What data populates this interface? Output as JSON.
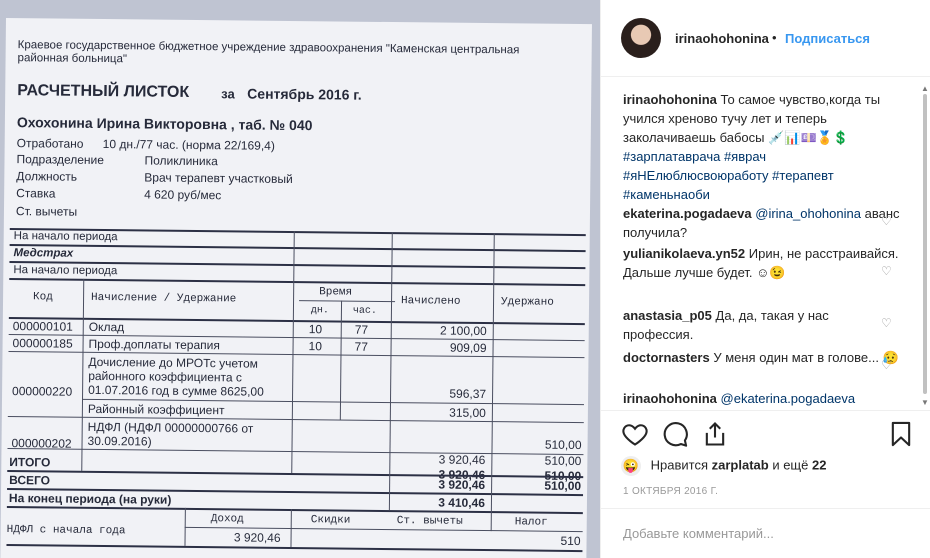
{
  "sheet": {
    "org": "Краевое государственное бюджетное учреждение здравоохранения \"Каменская центральная районная больница\"",
    "org_line1": "Краевое государственное бюджетное учреждение здравоохранения \"Каменская центральная",
    "org_line2": "районная больница\"",
    "title": "РАСЧЕТНЫЙ ЛИСТОК",
    "for_label": "за",
    "period": "Сентябрь 2016 г.",
    "employee": "Охохонина Ирина Викторовна , таб. № 040",
    "worked_label": "Отработано",
    "worked_value": "10 дн./77 час. (норма 22/169,4)",
    "dept_label": "Подразделение",
    "dept_value": "Поликлиника",
    "position_label": "Должность",
    "position_value": "Врач терапевт участковый",
    "rate_label": "Ставка",
    "rate_value": "4 620 руб/мес",
    "deductions_label": "Ст. вычеты",
    "start_period": "На начало периода",
    "medstrakh": "Медстрах",
    "start_period2": "На начало периода",
    "col_code": "Код",
    "col_accrual": "Начисление / Удержание",
    "col_time": "Время",
    "col_days": "дн.",
    "col_hours": "час.",
    "col_accrued": "Начислено",
    "col_withheld": "Удержано",
    "rows": [
      {
        "code": "000000101",
        "name": "Оклад",
        "days": "10",
        "hours": "77",
        "accrued": "2 100,00",
        "withheld": ""
      },
      {
        "code": "000000185",
        "name": "Проф.доплаты терапия",
        "days": "10",
        "hours": "77",
        "accrued": "909,09",
        "withheld": ""
      }
    ],
    "mrot_line1": "Дочисление до МРОТс учетом",
    "mrot_line2": "районного коэффициента с",
    "mrot_line3": "01.07.2016 год в сумме  8625,00",
    "mrot_code": "000000220",
    "mrot_accrued": "596,37",
    "regional_name": "Районный коэффициент",
    "regional_accrued": "315,00",
    "ndfl_line1": "НДФЛ (НДФЛ 00000000766 от",
    "ndfl_line2": "30.09.2016)",
    "ndfl_code": "000000202",
    "ndfl_withheld": "510,00",
    "sub_accrued": "3 920,46",
    "sub_withheld": "510,00",
    "itogo": "ИТОГО",
    "itogo_accrued": "3 920,46",
    "itogo_withheld": "510,00",
    "vsego": "ВСЕГО",
    "vsego_accrued": "3 920,46",
    "vsego_withheld": "510,00",
    "end_period": "На конец периода (на руки)",
    "end_value": "3 410,46",
    "ndfl_year": "НДФЛ с начала года",
    "f_income": "Доход",
    "f_discounts": "Скидки",
    "f_deductions": "Ст. вычеты",
    "f_tax": "Налог",
    "f_income_val": "3 920,46",
    "f_tax_val": "510"
  },
  "post": {
    "username": "irinaohohonina",
    "dot": "•",
    "follow": "Подписаться",
    "caption_user": "irinaohohonina",
    "caption_text": "То самое чувство,когда ты учился хреново тучу лет и теперь заколачиваешь бабосы",
    "caption_emoji": "💉📊💷🏅💲",
    "hashtags": "#зарплатаврача #яврач #яНЕлюблюсвоюработу #терапевт #каменьнаоби",
    "comments": [
      {
        "user": "ekaterina.pogadaeva",
        "mention": "@irina_ohohonina",
        "text": "аванс получила?"
      },
      {
        "user": "yulianikolaeva.yn52",
        "mention": "",
        "text": "Ирин, не расстраивайся. Дальше лучше будет. ☺😉"
      },
      {
        "user": "anastasia_p05",
        "mention": "",
        "text": "Да, да, такая у нас профессия."
      },
      {
        "user": "doctornasters",
        "mention": "",
        "text": "У меня один мат в голове... 😥"
      },
      {
        "user": "irinaohohonina",
        "mention": "@ekaterina.pogadaeva",
        "text": ""
      }
    ],
    "likes_prefix": "Нравится",
    "likes_user": "zarplatab",
    "likes_and": "и ещё",
    "likes_count": "22",
    "date": "1 ОКТЯБРЯ 2016 Г.",
    "add_comment_placeholder": "Добавьте комментарий..."
  },
  "icons": [
    "heart-icon",
    "comment-icon",
    "share-icon",
    "bookmark-icon",
    "emoji-icon",
    "scroll-up-icon",
    "scroll-down-icon"
  ]
}
